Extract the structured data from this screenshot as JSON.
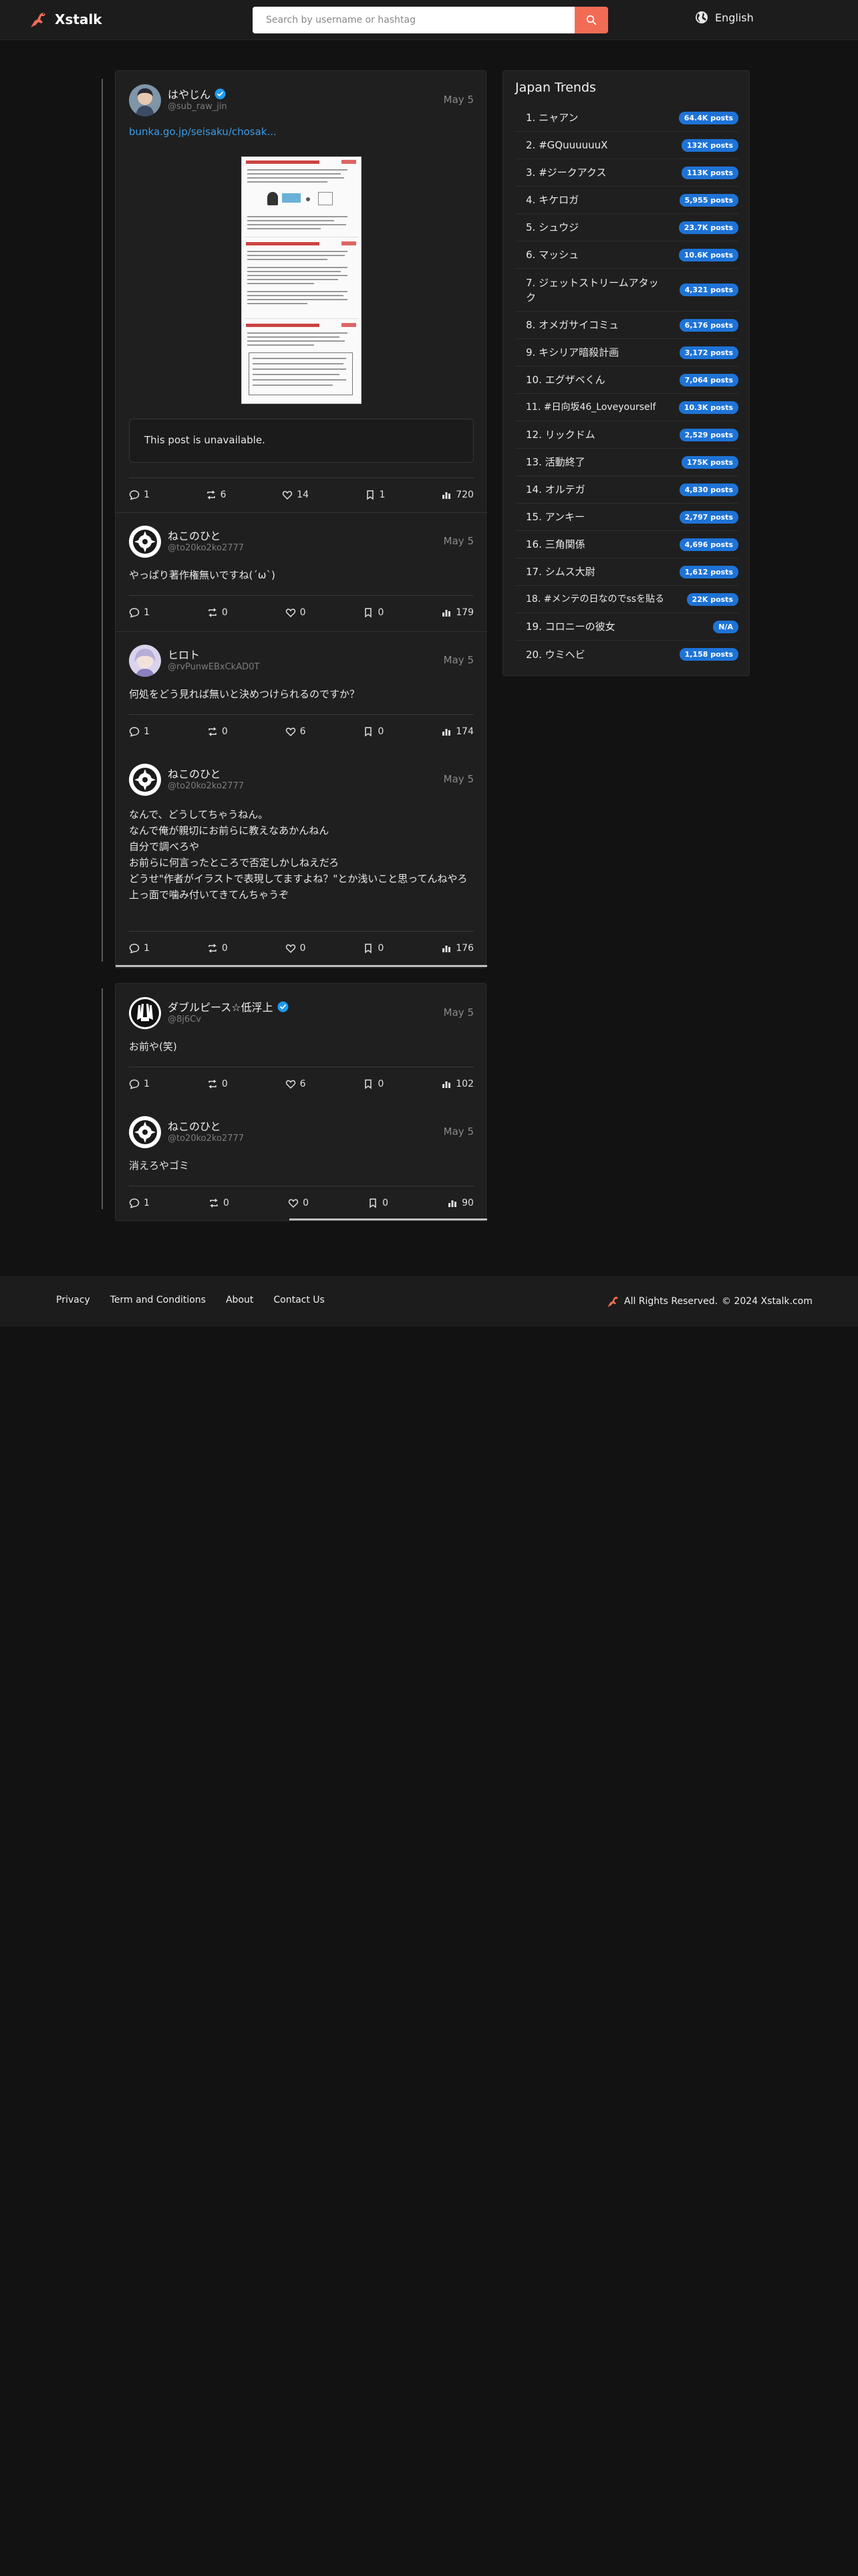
{
  "header": {
    "logo_text": "Xstalk",
    "search_placeholder": "Search by username or hashtag",
    "language": "English"
  },
  "threads": [
    {
      "posts": [
        {
          "name": "はやじん",
          "handle": "@sub_raw_jin",
          "date": "May 5",
          "link": "bunka.go.jp/seisaku/chosak...",
          "unavailable": "This post is unavailable.",
          "replies": "1",
          "reposts": "6",
          "likes": "14",
          "bookmarks": "1",
          "views": "720"
        },
        {
          "name": "ねこのひと",
          "handle": "@to20ko2ko2777",
          "date": "May 5",
          "text": "やっぱり著作権無いですね(´ω`)",
          "replies": "1",
          "reposts": "0",
          "likes": "0",
          "bookmarks": "0",
          "views": "179"
        },
        {
          "name": "ヒロト",
          "handle": "@rvPunwEBxCkAD0T",
          "date": "May 5",
          "text": "何処をどう見れば無いと決めつけられるのですか？",
          "replies": "1",
          "reposts": "0",
          "likes": "6",
          "bookmarks": "0",
          "views": "174"
        },
        {
          "name": "ねこのひと",
          "handle": "@to20ko2ko2777",
          "date": "May 5",
          "text": "なんで、どうしてちゃうねん。\nなんで俺が親切にお前らに教えなあかんねん\n自分で調べろや\nお前らに何言ったところで否定しかしねえだろ\nどうせ\"作者がイラストで表現してますよね？\"とか浅いこと思ってんねやろ\n上っ面で噛み付いてきてんちゃうぞ",
          "replies": "1",
          "reposts": "0",
          "likes": "0",
          "bookmarks": "0",
          "views": "176"
        }
      ]
    },
    {
      "posts": [
        {
          "name": "ダブルピース☆低浮上",
          "handle": "@8j6Cv",
          "date": "May 5",
          "text": "お前や(笑)",
          "replies": "1",
          "reposts": "0",
          "likes": "6",
          "bookmarks": "0",
          "views": "102"
        },
        {
          "name": "ねこのひと",
          "handle": "@to20ko2ko2777",
          "date": "May 5",
          "text": "消えろやゴミ",
          "replies": "1",
          "reposts": "0",
          "likes": "0",
          "bookmarks": "0",
          "views": "90"
        }
      ]
    }
  ],
  "trends": {
    "title": "Japan Trends",
    "items": [
      {
        "label": "1. ニャアン",
        "count": "64.4K posts"
      },
      {
        "label": "2. #GQuuuuuuX",
        "count": "132K posts"
      },
      {
        "label": "3. #ジークアクス",
        "count": "113K posts"
      },
      {
        "label": "4. キケロガ",
        "count": "5,955 posts"
      },
      {
        "label": "5. シュウジ",
        "count": "23.7K posts"
      },
      {
        "label": "6. マッシュ",
        "count": "10.6K posts"
      },
      {
        "label": "7. ジェットストリームアタック",
        "count": "4,321 posts"
      },
      {
        "label": "8. オメガサイコミュ",
        "count": "6,176 posts"
      },
      {
        "label": "9. キシリア暗殺計画",
        "count": "3,172 posts"
      },
      {
        "label": "10. エグザベくん",
        "count": "7,064 posts"
      },
      {
        "label": "11. #日向坂46_Loveyourself",
        "count": "10.3K posts"
      },
      {
        "label": "12. リックドム",
        "count": "2,529 posts"
      },
      {
        "label": "13. 活動終了",
        "count": "175K posts"
      },
      {
        "label": "14. オルテガ",
        "count": "4,830 posts"
      },
      {
        "label": "15. アンキー",
        "count": "2,797 posts"
      },
      {
        "label": "16. 三角関係",
        "count": "4,696 posts"
      },
      {
        "label": "17. シムス大尉",
        "count": "1,612 posts"
      },
      {
        "label": "18. #メンテの日なのでssを貼る",
        "count": "22K posts"
      },
      {
        "label": "19. コロニーの彼女",
        "count": "N/A"
      },
      {
        "label": "20. ウミヘビ",
        "count": "1,158 posts"
      }
    ]
  },
  "footer": {
    "links": [
      "Privacy",
      "Term and Conditions",
      "About",
      "Contact Us"
    ],
    "rights": "All Rights Reserved.",
    "copyright": "© 2024 Xstalk.com"
  },
  "colors": {
    "accent": "#f26b55",
    "badge": "#1e73d6",
    "link": "#3a9be6",
    "verified": "#1d9bf0"
  }
}
